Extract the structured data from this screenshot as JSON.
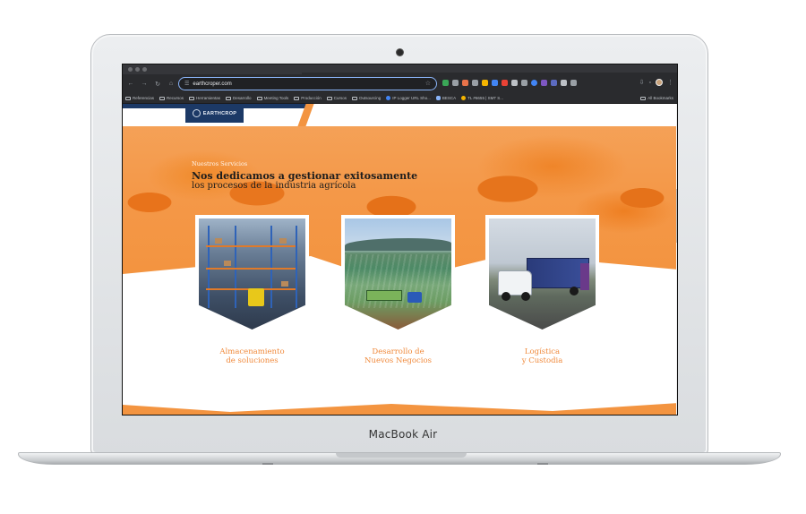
{
  "device": {
    "label": "MacBook Air"
  },
  "browser": {
    "url": "earthcroper.com",
    "bookmarks": [
      {
        "label": "Referencias"
      },
      {
        "label": "Recursos"
      },
      {
        "label": "Herramientas"
      },
      {
        "label": "Desarrollo"
      },
      {
        "label": "Meeting Tools"
      },
      {
        "label": "Producción"
      },
      {
        "label": "Cursos"
      },
      {
        "label": "Outsourcing"
      },
      {
        "label": "IP Logger URL Sho..."
      },
      {
        "label": "BESCA"
      },
      {
        "label": "TL #6655 | SMT S..."
      }
    ],
    "all_bookmarks_label": "All Bookmarks"
  },
  "site": {
    "logo_text": "EARTHCROP",
    "hero": {
      "eyebrow": "Nuestros Servicios",
      "headline": "Nos dedicamos a gestionar exitosamente",
      "subline": "los procesos de la industria agrícola"
    },
    "services": [
      {
        "line1": "Almacenamiento",
        "line2": "de soluciones"
      },
      {
        "line1": "Desarrollo de",
        "line2": "Nuevos Negocios"
      },
      {
        "line1": "Logística",
        "line2": "y Custodia"
      }
    ]
  },
  "colors": {
    "accent_orange": "#f39440",
    "label_orange": "#f08a3c",
    "brand_navy": "#1c3966"
  }
}
